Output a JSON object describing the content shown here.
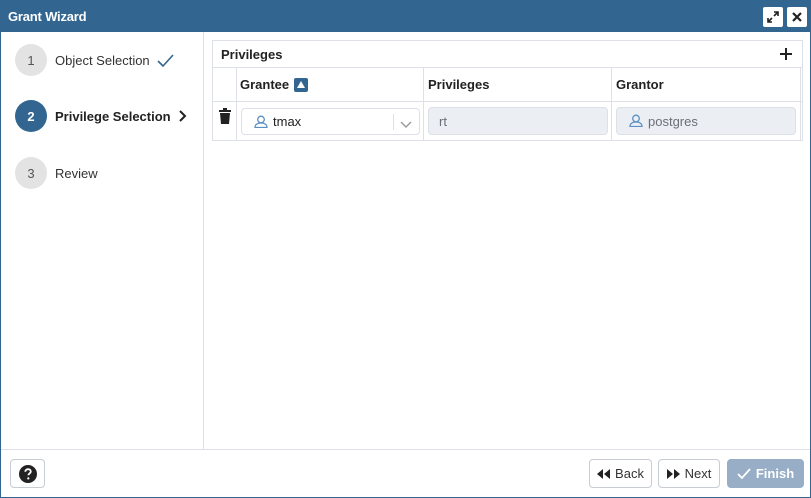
{
  "window": {
    "title": "Grant Wizard"
  },
  "steps": [
    {
      "number": "1",
      "label": "Object Selection",
      "state": "done"
    },
    {
      "number": "2",
      "label": "Privilege Selection",
      "state": "active"
    },
    {
      "number": "3",
      "label": "Review",
      "state": "pending"
    }
  ],
  "privileges_panel": {
    "title": "Privileges",
    "columns": [
      "Grantee",
      "Privileges",
      "Grantor"
    ],
    "rows": [
      {
        "grantee": "tmax",
        "privileges": "rt",
        "grantor": "postgres"
      }
    ]
  },
  "footer": {
    "back_label": "Back",
    "next_label": "Next",
    "finish_label": "Finish"
  },
  "colors": {
    "accent": "#326690",
    "finish_disabled": "#97aec6",
    "readonly_bg": "#ebeef3"
  }
}
